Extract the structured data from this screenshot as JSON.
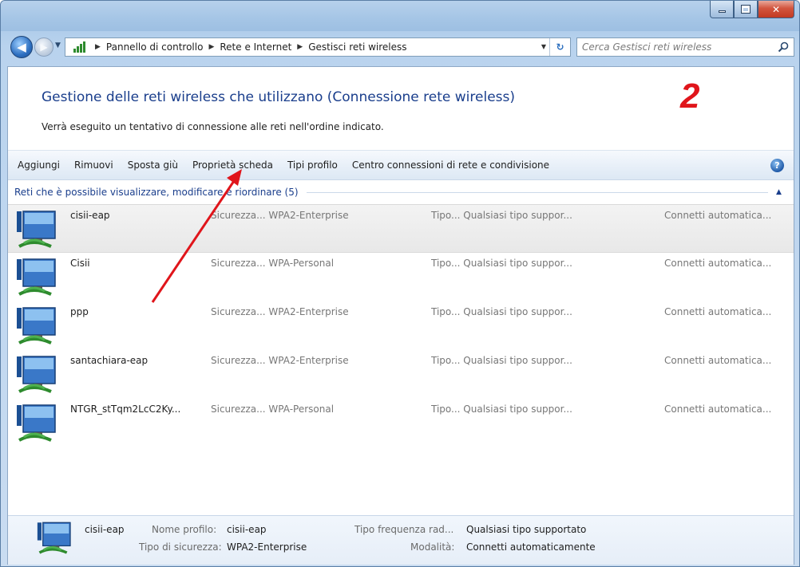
{
  "breadcrumb": [
    "Pannello di controllo",
    "Rete e Internet",
    "Gestisci reti wireless"
  ],
  "search": {
    "placeholder": "Cerca Gestisci reti wireless"
  },
  "header": {
    "title": "Gestione delle reti wireless che utilizzano (Connessione rete wireless)",
    "subtitle": "Verrà eseguito un tentativo di connessione alle reti nell'ordine indicato.",
    "annotation_number": "2"
  },
  "toolbar": {
    "add": "Aggiungi",
    "remove": "Rimuovi",
    "move_down": "Sposta giù",
    "adapter_properties": "Proprietà scheda",
    "profile_types": "Tipi profilo",
    "network_center": "Centro connessioni di rete e condivisione"
  },
  "group": {
    "title": "Reti che è possibile visualizzare, modificare e riordinare (5)"
  },
  "networks": [
    {
      "name": "cisii-eap",
      "security": "Sicurezza... WPA2-Enterprise",
      "type": "Tipo... Qualsiasi tipo suppor...",
      "mode": "Connetti automatica..."
    },
    {
      "name": "Cisii",
      "security": "Sicurezza... WPA-Personal",
      "type": "Tipo... Qualsiasi tipo suppor...",
      "mode": "Connetti automatica..."
    },
    {
      "name": "ppp",
      "security": "Sicurezza... WPA2-Enterprise",
      "type": "Tipo... Qualsiasi tipo suppor...",
      "mode": "Connetti automatica..."
    },
    {
      "name": "santachiara-eap",
      "security": "Sicurezza... WPA2-Enterprise",
      "type": "Tipo... Qualsiasi tipo suppor...",
      "mode": "Connetti automatica..."
    },
    {
      "name": "NTGR_stTqm2LcC2Ky...",
      "security": "Sicurezza... WPA-Personal",
      "type": "Tipo... Qualsiasi tipo suppor...",
      "mode": "Connetti automatica..."
    }
  ],
  "details": {
    "name": "cisii-eap",
    "profile_label": "Nome profilo:",
    "profile_value": "cisii-eap",
    "security_label": "Tipo di sicurezza:",
    "security_value": "WPA2-Enterprise",
    "radio_label": "Tipo frequenza rad...",
    "radio_value": "Qualsiasi tipo supportato",
    "mode_label": "Modalità:",
    "mode_value": "Connetti automaticamente"
  },
  "colors": {
    "title_blue": "#1a3e8c",
    "annotation_red": "#e0151b",
    "signal_green": "#2e8b2e"
  }
}
